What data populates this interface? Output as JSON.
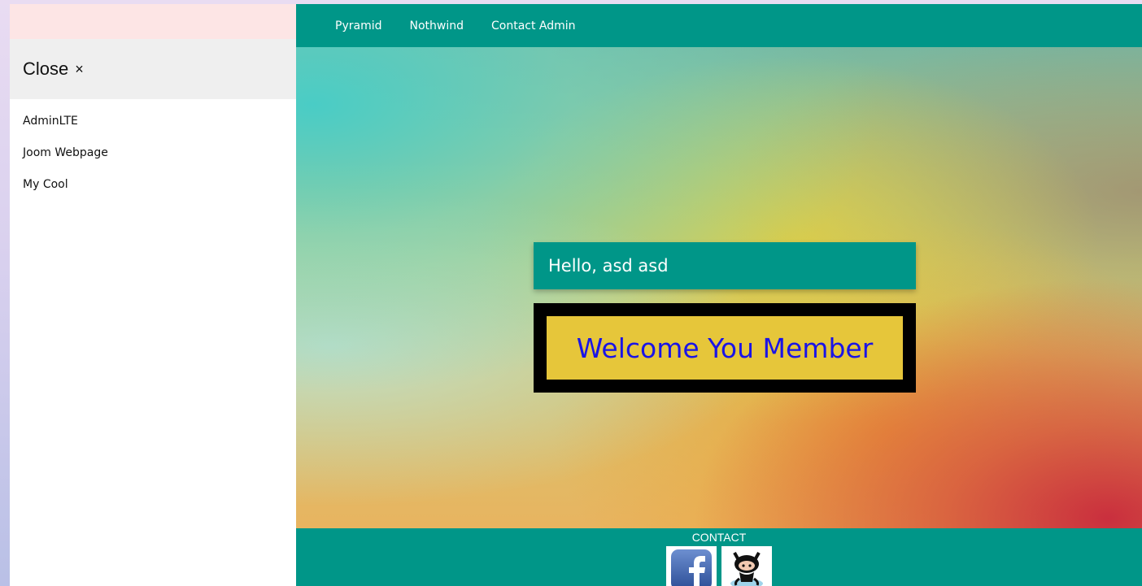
{
  "sidebar": {
    "close_label": "Close",
    "close_symbol": "×",
    "items": [
      {
        "label": "AdminLTE"
      },
      {
        "label": "Joom Webpage"
      },
      {
        "label": "My Cool"
      }
    ]
  },
  "nav": {
    "links": [
      {
        "label": "Pyramid"
      },
      {
        "label": "Nothwind"
      },
      {
        "label": "Contact Admin"
      }
    ]
  },
  "hero": {
    "hello_text": "Hello, asd asd",
    "welcome_text": "Welcome You Member"
  },
  "footer": {
    "title": "CONTACT",
    "icons": [
      "facebook-icon",
      "github-icon"
    ]
  },
  "colors": {
    "primary": "#009688",
    "welcome_text": "#1a14e6",
    "welcome_bg": "#e6c63a",
    "sidebar_top": "#fde5e5"
  }
}
